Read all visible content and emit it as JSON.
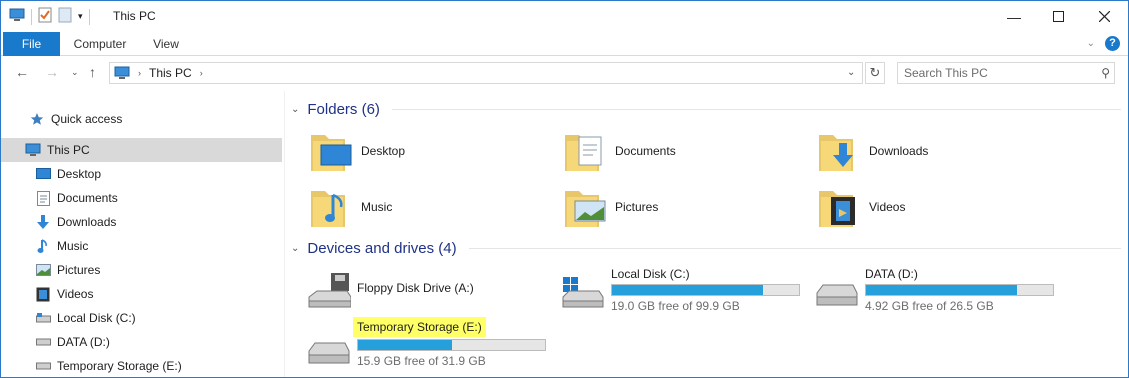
{
  "window": {
    "title": "This PC",
    "accent": "#1979ca"
  },
  "ribbon": {
    "tabs": [
      {
        "label": "File"
      },
      {
        "label": "Computer"
      },
      {
        "label": "View"
      }
    ]
  },
  "address": {
    "location": "This PC",
    "search_placeholder": "Search This PC"
  },
  "navpane": {
    "items": [
      {
        "label": "Quick access",
        "icon": "star-icon"
      },
      {
        "label": "This PC",
        "icon": "computer-icon",
        "selected": true
      },
      {
        "label": "Desktop",
        "icon": "desktop-icon"
      },
      {
        "label": "Documents",
        "icon": "documents-icon"
      },
      {
        "label": "Downloads",
        "icon": "downloads-icon"
      },
      {
        "label": "Music",
        "icon": "music-icon"
      },
      {
        "label": "Pictures",
        "icon": "pictures-icon"
      },
      {
        "label": "Videos",
        "icon": "videos-icon"
      },
      {
        "label": "Local Disk (C:)",
        "icon": "drive-icon"
      },
      {
        "label": "DATA (D:)",
        "icon": "drive-icon"
      },
      {
        "label": "Temporary Storage (E:)",
        "icon": "drive-icon"
      }
    ]
  },
  "content": {
    "folders_header": "Folders (6)",
    "folders": [
      {
        "label": "Desktop",
        "icon": "desktop-folder-icon"
      },
      {
        "label": "Documents",
        "icon": "documents-folder-icon"
      },
      {
        "label": "Downloads",
        "icon": "downloads-folder-icon"
      },
      {
        "label": "Music",
        "icon": "music-folder-icon"
      },
      {
        "label": "Pictures",
        "icon": "pictures-folder-icon"
      },
      {
        "label": "Videos",
        "icon": "videos-folder-icon"
      }
    ],
    "drives_header": "Devices and drives (4)",
    "drives": [
      {
        "name": "Floppy Disk Drive (A:)",
        "icon": "floppy-drive-icon"
      },
      {
        "name": "Local Disk (C:)",
        "free": "19.0 GB free of 99.9 GB",
        "used_fraction": 0.81,
        "icon": "windows-drive-icon"
      },
      {
        "name": "DATA (D:)",
        "free": "4.92 GB free of 26.5 GB",
        "used_fraction": 0.81,
        "icon": "drive-icon"
      },
      {
        "name": "Temporary Storage (E:)",
        "free": "15.9 GB free of 31.9 GB",
        "used_fraction": 0.5,
        "icon": "drive-icon",
        "highlighted": true
      }
    ]
  }
}
